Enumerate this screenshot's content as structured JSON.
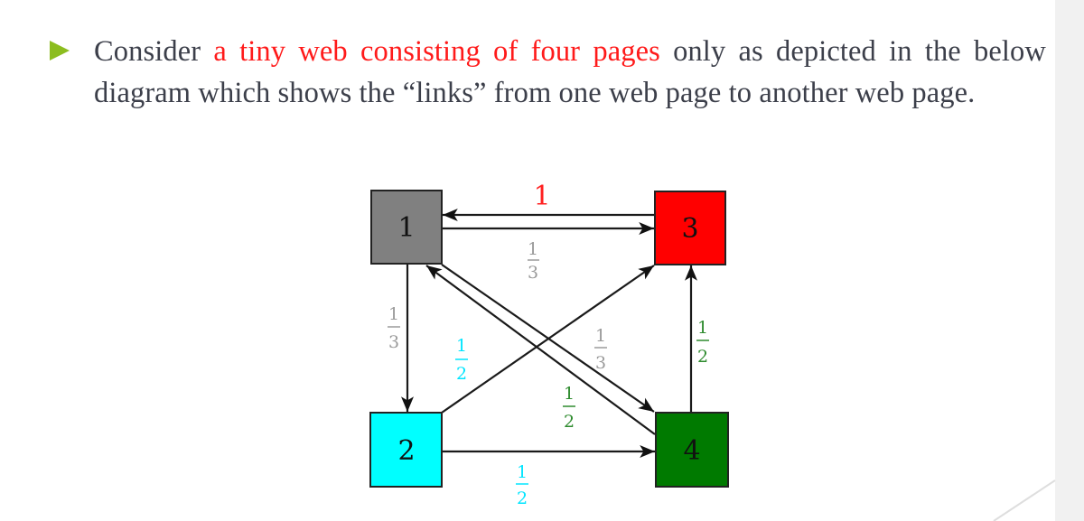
{
  "slide": {
    "bullet_color": "#8cbd1f",
    "text_color": "#3c3f4a",
    "highlight_color": "#ff1a1a",
    "paragraph": {
      "part1": "Consider ",
      "highlight": "a tiny web consisting of four pages",
      "part2": " only as depicted in the below diagram which shows the “links” from one web page to another web page."
    }
  },
  "diagram": {
    "nodes": [
      {
        "id": "1",
        "label": "1",
        "color": "#808080"
      },
      {
        "id": "2",
        "label": "2",
        "color": "#00ffff"
      },
      {
        "id": "3",
        "label": "3",
        "color": "#ff0000"
      },
      {
        "id": "4",
        "label": "4",
        "color": "#007a00"
      }
    ],
    "edges": [
      {
        "from": "3",
        "to": "1",
        "weight": "1",
        "label_num": "1",
        "label_den": "",
        "label_color": "#ff2020"
      },
      {
        "from": "1",
        "to": "3",
        "weight": "1/3",
        "label_num": "1",
        "label_den": "3",
        "label_color": "#9a9a9a"
      },
      {
        "from": "1",
        "to": "2",
        "weight": "1/3",
        "label_num": "1",
        "label_den": "3",
        "label_color": "#9a9a9a"
      },
      {
        "from": "1",
        "to": "4",
        "weight": "1/3",
        "label_num": "1",
        "label_den": "3",
        "label_color": "#9a9a9a"
      },
      {
        "from": "2",
        "to": "3",
        "weight": "1/2",
        "label_num": "1",
        "label_den": "2",
        "label_color": "#00e5ff"
      },
      {
        "from": "2",
        "to": "4",
        "weight": "1/2",
        "label_num": "1",
        "label_den": "2",
        "label_color": "#00e5ff"
      },
      {
        "from": "4",
        "to": "1",
        "weight": "1/2",
        "label_num": "1",
        "label_den": "2",
        "label_color": "#2e8b2e"
      },
      {
        "from": "4",
        "to": "3",
        "weight": "1/2",
        "label_num": "1",
        "label_den": "2",
        "label_color": "#2e8b2e"
      }
    ]
  }
}
